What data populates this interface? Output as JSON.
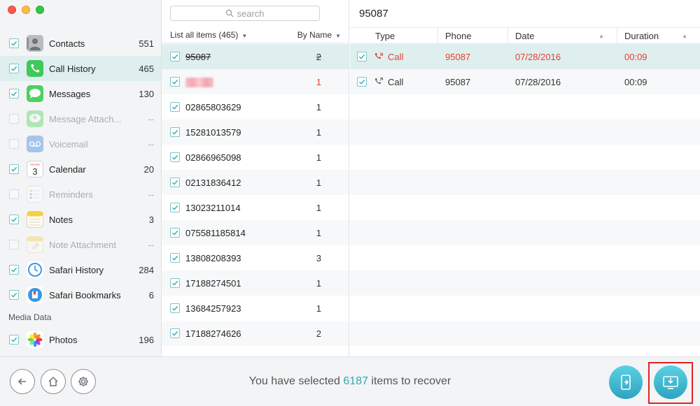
{
  "sidebar": {
    "categories": [
      {
        "label": "Contacts",
        "count": "551",
        "checked": true,
        "enabled": true,
        "icon": "contacts-icon"
      },
      {
        "label": "Call History",
        "count": "465",
        "checked": true,
        "enabled": true,
        "icon": "phone-icon"
      },
      {
        "label": "Messages",
        "count": "130",
        "checked": true,
        "enabled": true,
        "icon": "messages-icon"
      },
      {
        "label": "Message Attach...",
        "count": "--",
        "checked": false,
        "enabled": false,
        "icon": "message-attachment-icon"
      },
      {
        "label": "Voicemail",
        "count": "--",
        "checked": false,
        "enabled": false,
        "icon": "voicemail-icon"
      },
      {
        "label": "Calendar",
        "count": "20",
        "checked": true,
        "enabled": true,
        "icon": "calendar-icon"
      },
      {
        "label": "Reminders",
        "count": "--",
        "checked": false,
        "enabled": false,
        "icon": "reminders-icon"
      },
      {
        "label": "Notes",
        "count": "3",
        "checked": true,
        "enabled": true,
        "icon": "notes-icon"
      },
      {
        "label": "Note Attachment",
        "count": "--",
        "checked": false,
        "enabled": false,
        "icon": "note-attachment-icon"
      },
      {
        "label": "Safari History",
        "count": "284",
        "checked": true,
        "enabled": true,
        "icon": "safari-history-icon"
      },
      {
        "label": "Safari Bookmarks",
        "count": "6",
        "checked": true,
        "enabled": true,
        "icon": "safari-bookmarks-icon"
      }
    ],
    "section_media": "Media Data",
    "media": [
      {
        "label": "Photos",
        "count": "196",
        "checked": true,
        "enabled": true,
        "icon": "photos-icon"
      }
    ],
    "calendar_day": "3",
    "calendar_weekday": "Sunday"
  },
  "middle": {
    "search_placeholder": "search",
    "list_label": "List all items (465)",
    "sort_label": "By Name",
    "items": [
      {
        "name": "95087",
        "count": "2"
      },
      {
        "name": "",
        "count": "1",
        "redacted": true
      },
      {
        "name": "02865803629",
        "count": "1"
      },
      {
        "name": "15281013579",
        "count": "1"
      },
      {
        "name": "02866965098",
        "count": "1"
      },
      {
        "name": "02131836412",
        "count": "1"
      },
      {
        "name": "13023211014",
        "count": "1"
      },
      {
        "name": "075581185814",
        "count": "1"
      },
      {
        "name": "13808208393",
        "count": "3"
      },
      {
        "name": "17188274501",
        "count": "1"
      },
      {
        "name": "13684257923",
        "count": "1"
      },
      {
        "name": "17188274626",
        "count": "2"
      }
    ]
  },
  "detail": {
    "title": "95087",
    "columns": {
      "type": "Type",
      "phone": "Phone",
      "date": "Date",
      "duration": "Duration"
    },
    "rows": [
      {
        "type": "Call",
        "phone": "95087",
        "date": "07/28/2016",
        "duration": "00:09",
        "missed": true
      },
      {
        "type": "Call",
        "phone": "95087",
        "date": "07/28/2016",
        "duration": "00:09",
        "missed": false
      }
    ]
  },
  "footer": {
    "status_prefix": "You have selected ",
    "selected_count": "6187",
    "status_suffix": " items to recover"
  },
  "colors": {
    "accent": "#39a6b2",
    "missed": "#e8402e",
    "selected_row": "#dfeeee"
  }
}
